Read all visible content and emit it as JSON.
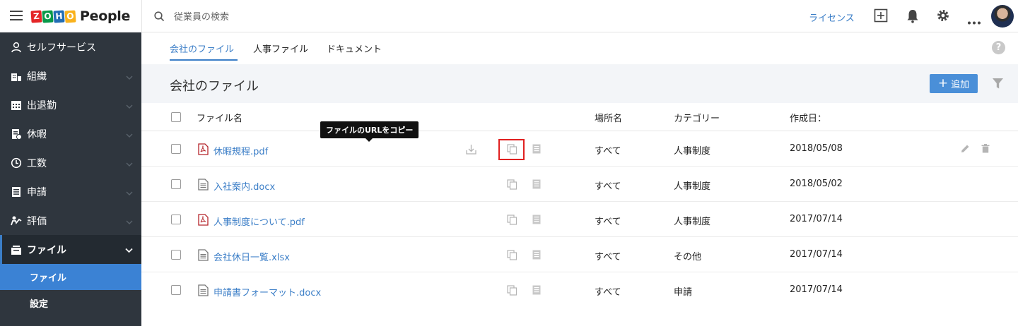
{
  "topbar": {
    "logo_letters": [
      "Z",
      "O",
      "H",
      "O"
    ],
    "logo_letter_colors": [
      "#e42527",
      "#089949",
      "#226db4",
      "#f9b21d"
    ],
    "product_name": "People",
    "search_placeholder": "従業員の検索",
    "license_link": "ライセンス",
    "icons": [
      "menu-icon",
      "search-icon",
      "add-box-icon",
      "bell-icon",
      "gear-icon",
      "more-icon",
      "avatar"
    ]
  },
  "sidebar": {
    "items": [
      {
        "label": "セルフサービス",
        "icon": "person-icon"
      },
      {
        "label": "組織",
        "icon": "org-icon"
      },
      {
        "label": "出退勤",
        "icon": "calendar-icon"
      },
      {
        "label": "休暇",
        "icon": "leave-icon"
      },
      {
        "label": "工数",
        "icon": "clock-icon"
      },
      {
        "label": "申請",
        "icon": "form-icon"
      },
      {
        "label": "評価",
        "icon": "appraisal-icon"
      },
      {
        "label": "ファイル",
        "icon": "files-icon"
      }
    ],
    "sub_items": [
      {
        "label": "ファイル"
      },
      {
        "label": "設定"
      }
    ],
    "accent": "#3b82d4"
  },
  "tabs": [
    "会社のファイル",
    "人事ファイル",
    "ドキュメント"
  ],
  "content": {
    "title": "会社のファイル",
    "add_label": "追加",
    "add_plus": "+",
    "help": "?"
  },
  "table": {
    "headers": {
      "name": "ファイル名",
      "location": "場所名",
      "category": "カテゴリー",
      "created": "作成日："
    },
    "rows": [
      {
        "name": "休暇規程.pdf",
        "type": "pdf",
        "location": "すべて",
        "category": "人事制度",
        "date": "2018/05/08"
      },
      {
        "name": "入社案内.docx",
        "type": "doc",
        "location": "すべて",
        "category": "人事制度",
        "date": "2018/05/02"
      },
      {
        "name": "人事制度について.pdf",
        "type": "pdf",
        "location": "すべて",
        "category": "人事制度",
        "date": "2017/07/14"
      },
      {
        "name": "会社休日一覧.xlsx",
        "type": "doc",
        "location": "すべて",
        "category": "その他",
        "date": "2017/07/14"
      },
      {
        "name": "申請書フォーマット.docx",
        "type": "doc",
        "location": "すべて",
        "category": "申請",
        "date": "2017/07/14"
      }
    ]
  },
  "tooltip": "ファイルのURLをコピー"
}
